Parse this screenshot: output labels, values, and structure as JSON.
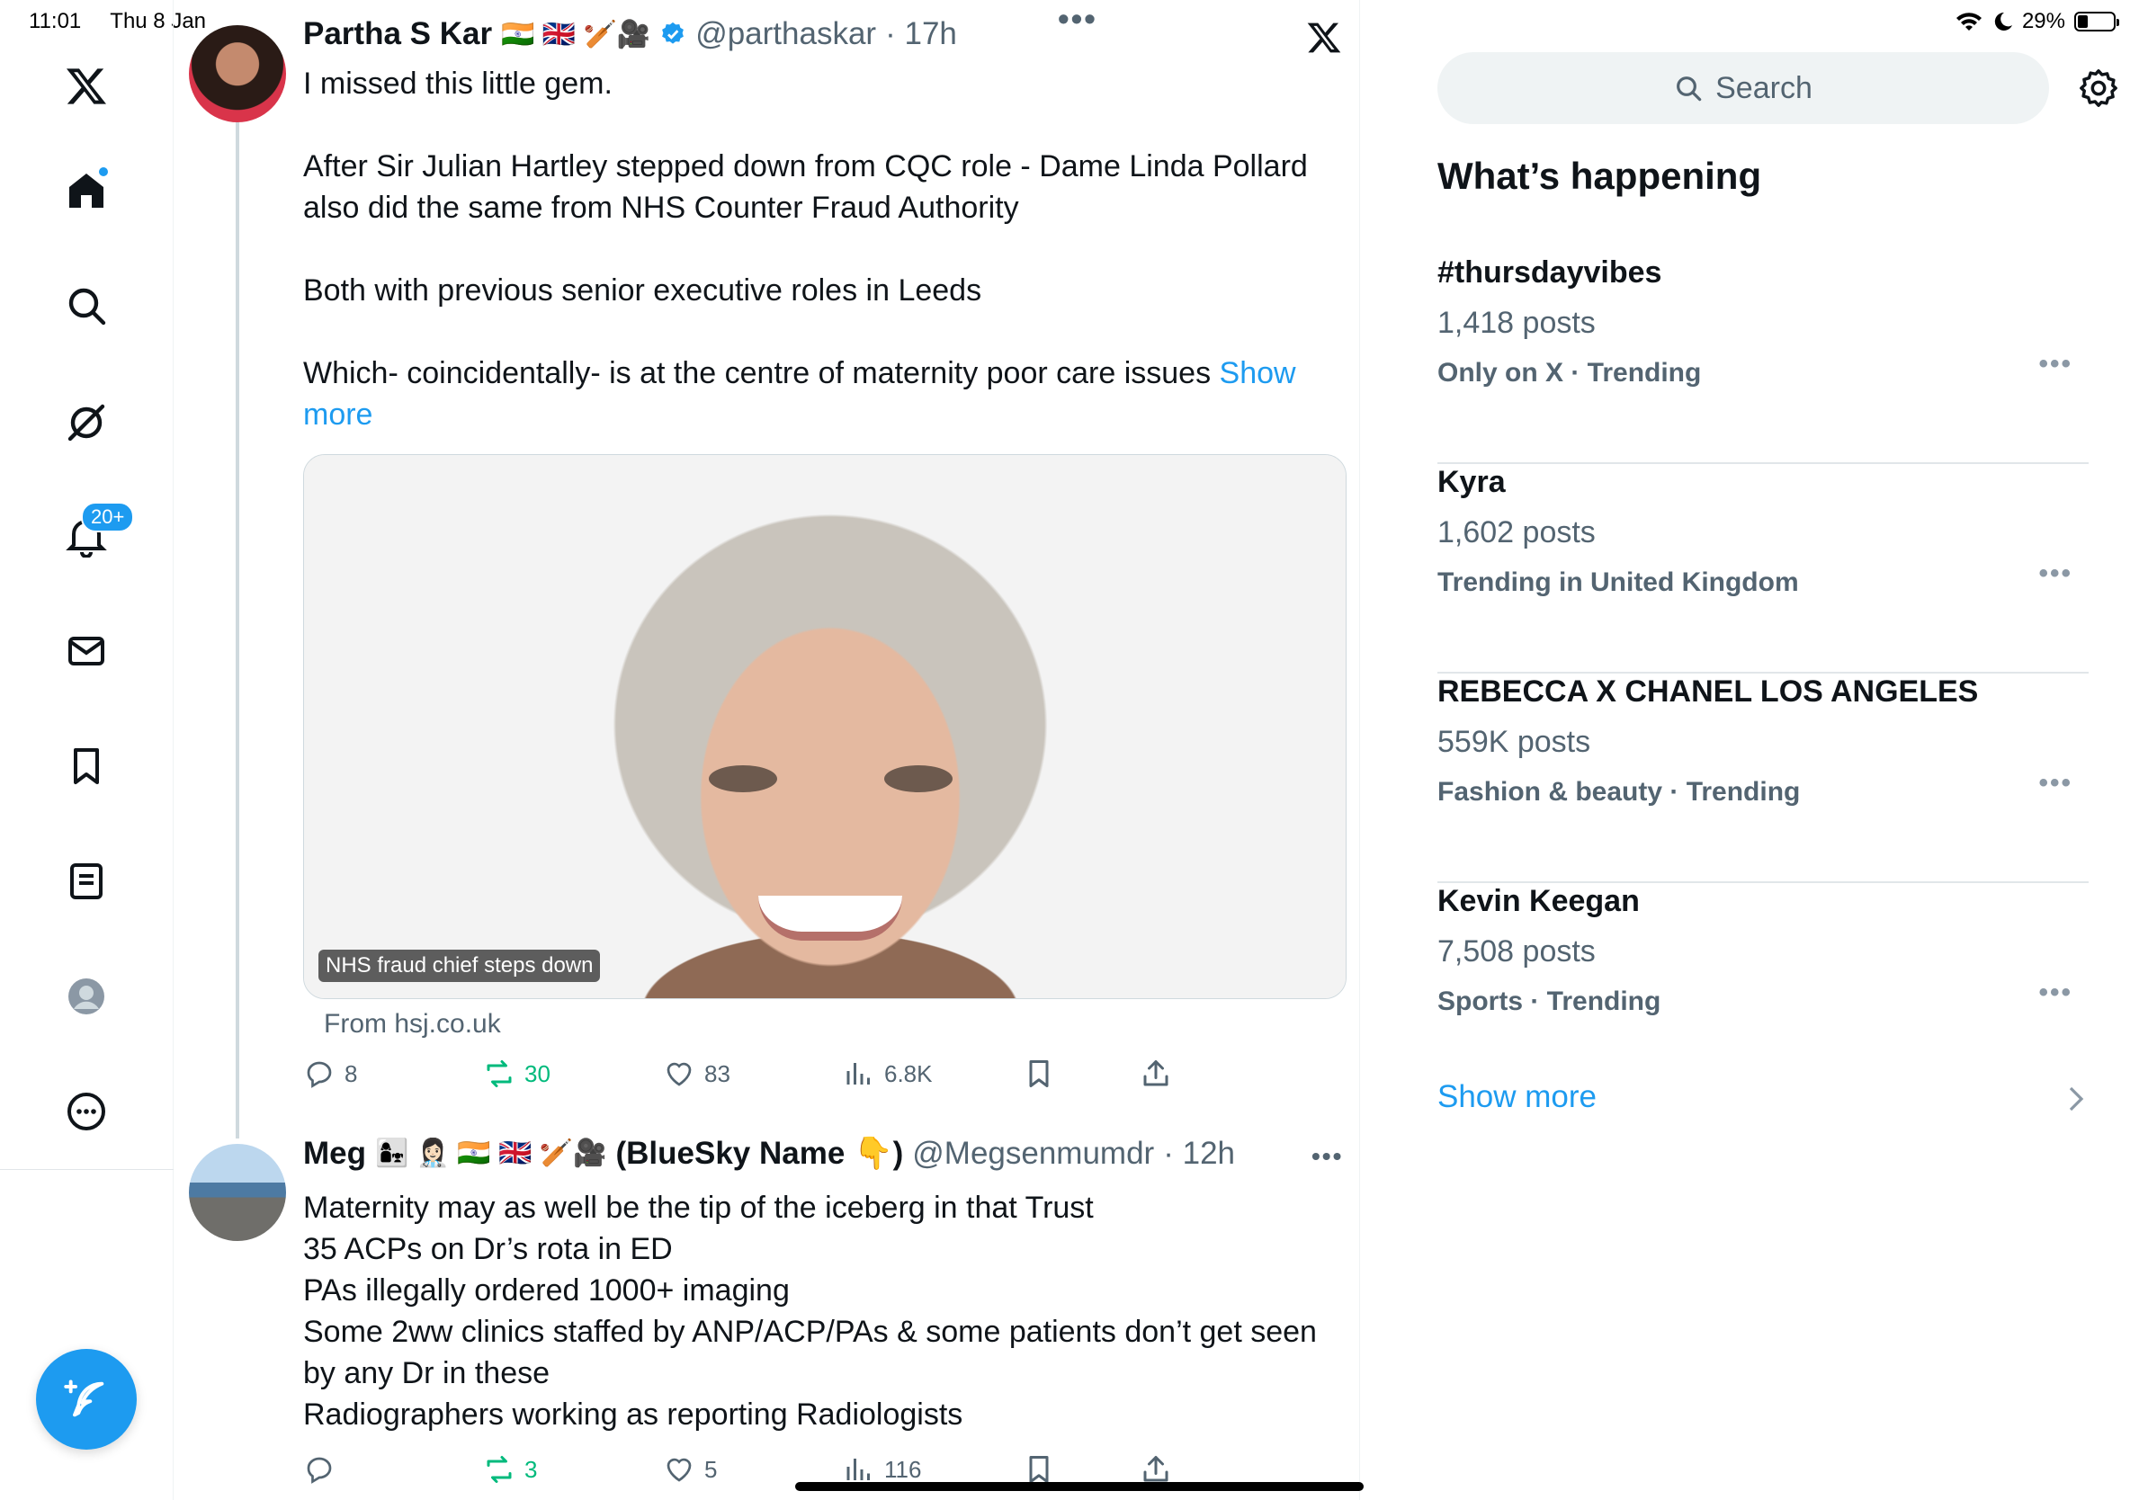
{
  "status_bar": {
    "time": "11:01",
    "date": "Thu 8 Jan",
    "battery": "29%",
    "battery_level": 0.29
  },
  "rail": {
    "items": [
      "x-logo",
      "home-icon",
      "search-icon",
      "grok-icon",
      "notifications-icon",
      "messages-icon",
      "bookmarks-icon",
      "lists-icon",
      "profile-icon",
      "more-icon"
    ],
    "notifications_badge": "20+"
  },
  "tweets": [
    {
      "name": "Partha S Kar",
      "emojis": "🇮🇳 🇬🇧 🏏🎥",
      "handle": "@parthaskar",
      "time": "· 17h",
      "body": [
        "I missed this little gem.",
        "After Sir Julian Hartley stepped down from CQC role - Dame Linda Pollard also did the same from NHS Counter Fraud Authority",
        "Both with previous senior executive roles in Leeds",
        "Which- coincidentally- is at the centre of maternity poor care issues "
      ],
      "show_more": "Show more",
      "card_caption": "NHS fraud chief steps down",
      "card_source": "From hsj.co.uk",
      "replies": "8",
      "reposts": "30",
      "likes": "83",
      "views": "6.8K"
    },
    {
      "name": "Meg",
      "emojis": "👩‍👧 👩🏻‍⚕️ 🇮🇳 🇬🇧 🏏🎥",
      "name_suffix": "(BlueSky Name 👇)",
      "handle": "@Megsenmumdr",
      "time": "· 12h",
      "body": [
        "Maternity may as well be the tip of the iceberg in that Trust",
        "35 ACPs on Dr’s rota in ED",
        "PAs illegally ordered 1000+ imaging",
        "Some 2ww clinics staffed by ANP/ACP/PAs & some patients don’t get seen by any Dr in these",
        "Radiographers working as reporting Radiologists"
      ],
      "replies": "",
      "reposts": "3",
      "likes": "5",
      "views": "116"
    }
  ],
  "sidebar": {
    "search_placeholder": "Search",
    "title": "What’s happening",
    "trends": [
      {
        "name": "#thursdayvibes",
        "posts": "1,418 posts",
        "meta": "Only on X · Trending"
      },
      {
        "name": "Kyra",
        "posts": "1,602 posts",
        "meta": "Trending in United Kingdom"
      },
      {
        "name": "REBECCA X CHANEL LOS ANGELES",
        "posts": "559K posts",
        "meta": "Fashion & beauty · Trending"
      },
      {
        "name": "Kevin Keegan",
        "posts": "7,508 posts",
        "meta": "Sports · Trending"
      }
    ],
    "show_more": "Show more"
  },
  "colors": {
    "accent": "#1d9bf0",
    "repost_green": "#00ba7c",
    "secondary_text": "#536471"
  }
}
